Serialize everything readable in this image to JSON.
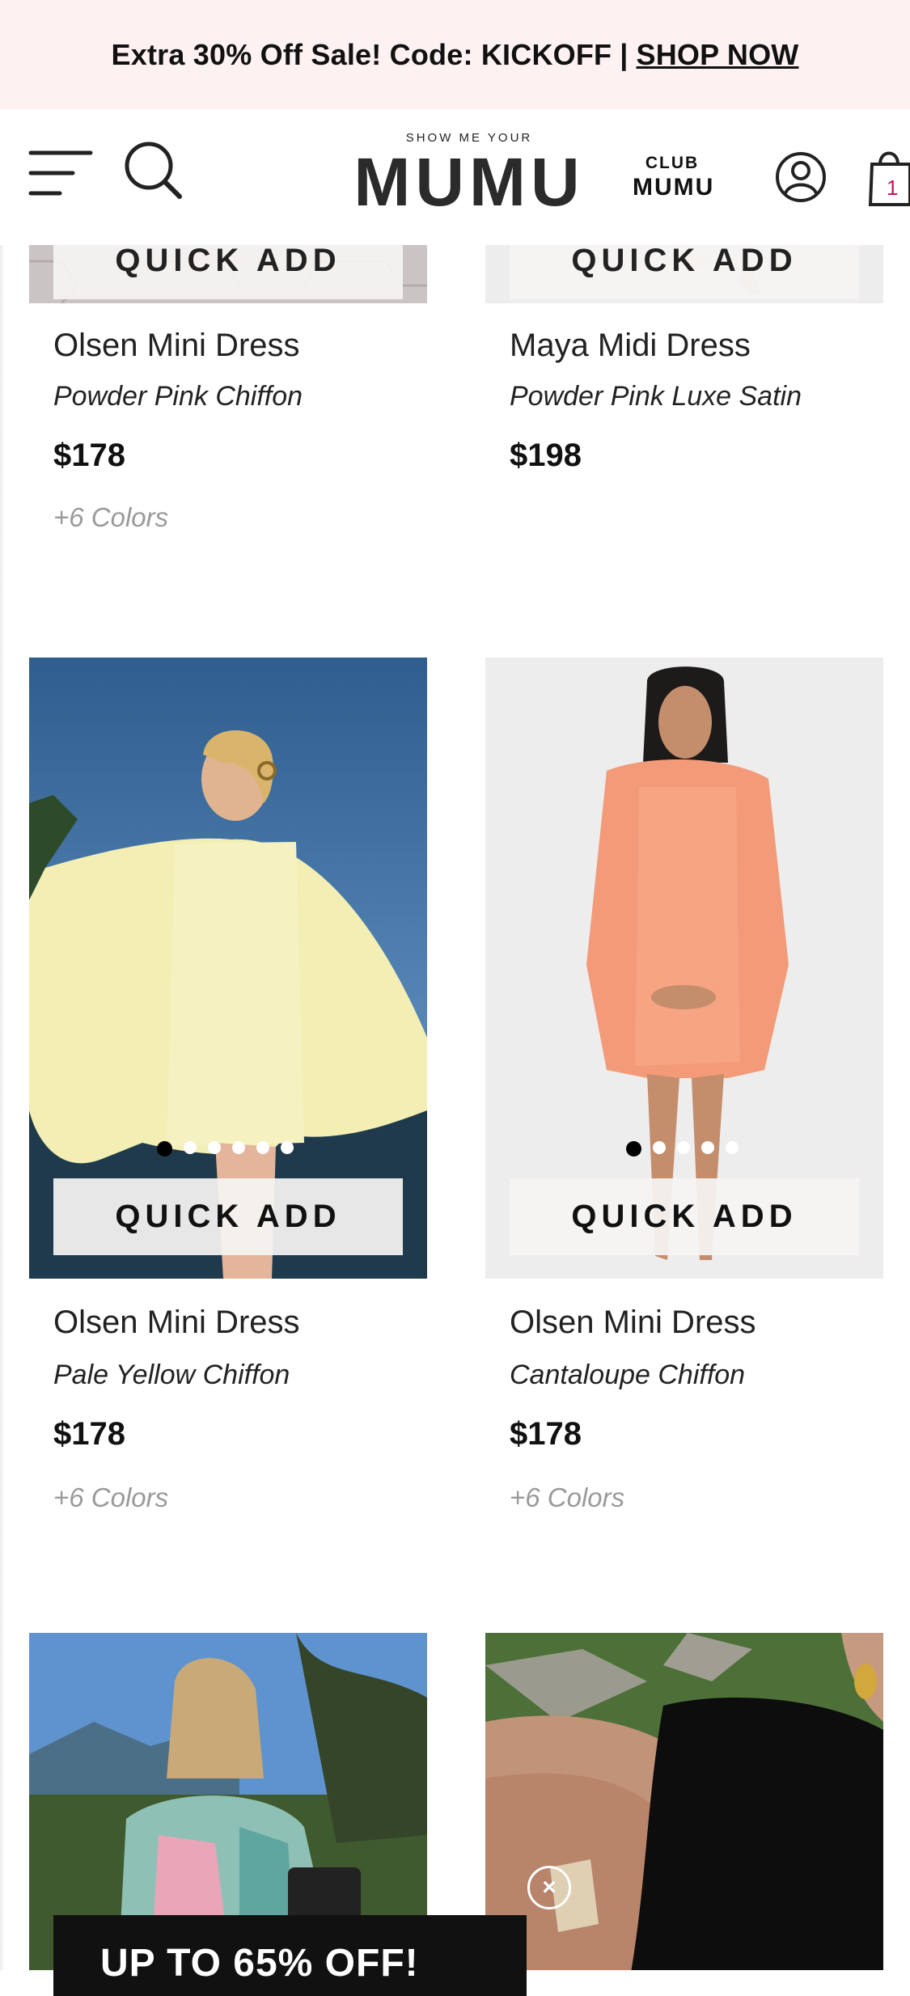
{
  "promo_bar": {
    "text": "Extra 30% Off Sale! Code: KICKOFF",
    "separator": "|",
    "link": "SHOP NOW"
  },
  "header": {
    "logo_small": "SHOW ME YOUR",
    "logo_big": "MUMU",
    "club_line1": "CLUB",
    "club_line2": "MUMU",
    "cart_count": "1",
    "icons": [
      "menu-icon",
      "search-icon",
      "account-icon",
      "cart-icon"
    ]
  },
  "products": [
    {
      "name": "Olsen Mini Dress",
      "color": "Powder Pink Chiffon",
      "price": "$178",
      "more_colors": "+6 Colors",
      "quick_add": "QUICK ADD"
    },
    {
      "name": "Maya Midi Dress",
      "color": "Powder Pink Luxe Satin",
      "price": "$198",
      "more_colors": "",
      "quick_add": "QUICK ADD"
    },
    {
      "name": "Olsen Mini Dress",
      "color": "Pale Yellow Chiffon",
      "price": "$178",
      "more_colors": "+6 Colors",
      "quick_add": "QUICK ADD"
    },
    {
      "name": "Olsen Mini Dress",
      "color": "Cantaloupe Chiffon",
      "price": "$178",
      "more_colors": "+6 Colors",
      "quick_add": "QUICK ADD"
    }
  ],
  "bottom_promo": {
    "text": "UP TO 65% OFF!",
    "close": "×"
  },
  "colors": {
    "promo_bg": "#fdf2f1",
    "cart_badge": "#c2185b",
    "muted_text": "#9a9a9a"
  }
}
